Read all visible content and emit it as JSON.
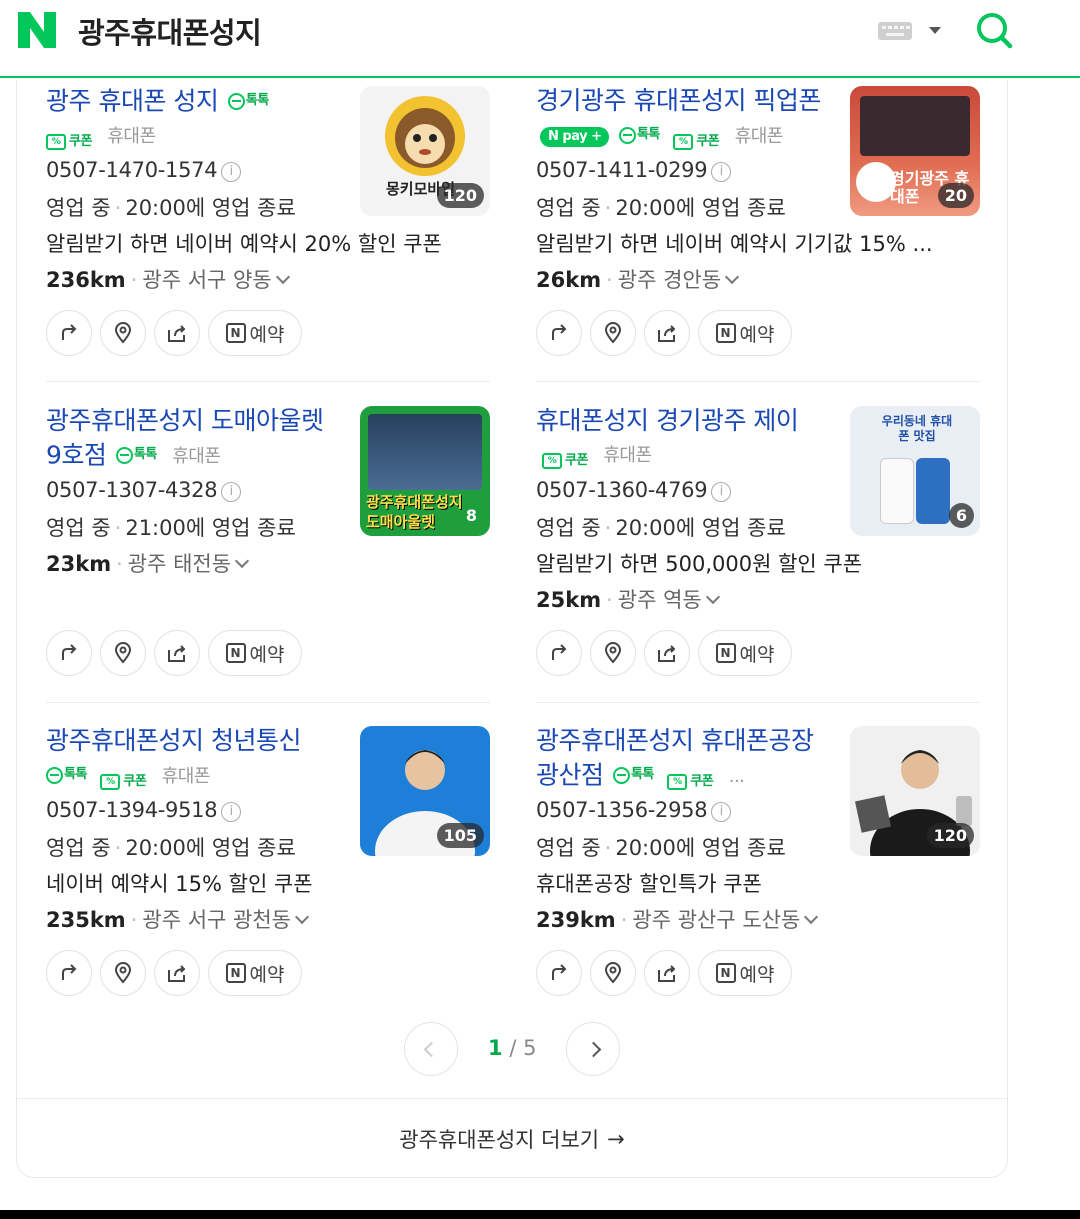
{
  "search": {
    "query": "광주휴대폰성지"
  },
  "colors": {
    "brand": "#03c75a",
    "link": "#1a49b5"
  },
  "results": [
    {
      "title": "광주 휴대폰 성지",
      "badges": [
        "톡톡",
        "쿠폰"
      ],
      "category": "휴대폰",
      "phone": "0507-1470-1574",
      "status": "영업 중",
      "hours": "20:00에 영업 종료",
      "promo": "알림받기 하면 네이버 예약시 20% 할인 쿠폰",
      "distance": "236km",
      "address": "광주 서구 양동",
      "photo_count": "120",
      "thumb_text": "몽키모바일"
    },
    {
      "title": "경기광주 휴대폰성지 픽업폰",
      "badges": [
        "pay",
        "톡톡",
        "쿠폰"
      ],
      "category": "휴대폰",
      "phone": "0507-1411-0299",
      "status": "영업 중",
      "hours": "20:00에 영업 종료",
      "promo": "알림받기 하면 네이버 예약시 기기값 15% ...",
      "distance": "26km",
      "address": "광주 경안동",
      "photo_count": "20",
      "thumb_text": "경기광주 휴대폰"
    },
    {
      "title": "광주휴대폰성지 도매아울렛 9호점",
      "badges": [
        "톡톡"
      ],
      "category": "휴대폰",
      "phone": "0507-1307-4328",
      "status": "영업 중",
      "hours": "21:00에 영업 종료",
      "promo": "",
      "distance": "23km",
      "address": "광주 태전동",
      "photo_count": "8",
      "thumb_text": "광주휴대폰성지 도매아울렛"
    },
    {
      "title": "휴대폰성지 경기광주 제이",
      "badges": [
        "쿠폰"
      ],
      "category": "휴대폰",
      "phone": "0507-1360-4769",
      "status": "영업 중",
      "hours": "20:00에 영업 종료",
      "promo": "알림받기 하면 500,000원 할인 쿠폰",
      "distance": "25km",
      "address": "광주 역동",
      "photo_count": "6",
      "thumb_text": "우리동네 휴대폰 맛집"
    },
    {
      "title": "광주휴대폰성지 청년통신",
      "badges": [
        "톡톡",
        "쿠폰"
      ],
      "category": "휴대폰",
      "phone": "0507-1394-9518",
      "status": "영업 중",
      "hours": "20:00에 영업 종료",
      "promo": "네이버 예약시 15% 할인 쿠폰",
      "distance": "235km",
      "address": "광주 서구 광천동",
      "photo_count": "105",
      "thumb_text": ""
    },
    {
      "title": "광주휴대폰성지 휴대폰공장 광산점",
      "badges": [
        "톡톡",
        "쿠폰"
      ],
      "category": "...",
      "phone": "0507-1356-2958",
      "status": "영업 중",
      "hours": "20:00에 영업 종료",
      "promo": "휴대폰공장 할인특가 쿠폰",
      "distance": "239km",
      "address": "광주 광산구 도산동",
      "photo_count": "120",
      "thumb_text": ""
    }
  ],
  "labels": {
    "talk": "톡톡",
    "coupon": "쿠폰",
    "pay": "pay",
    "reserve": "예약",
    "n": "N"
  },
  "pagination": {
    "current": "1",
    "separator": "/",
    "total": "5"
  },
  "more": {
    "label": "광주휴대폰성지 더보기"
  }
}
